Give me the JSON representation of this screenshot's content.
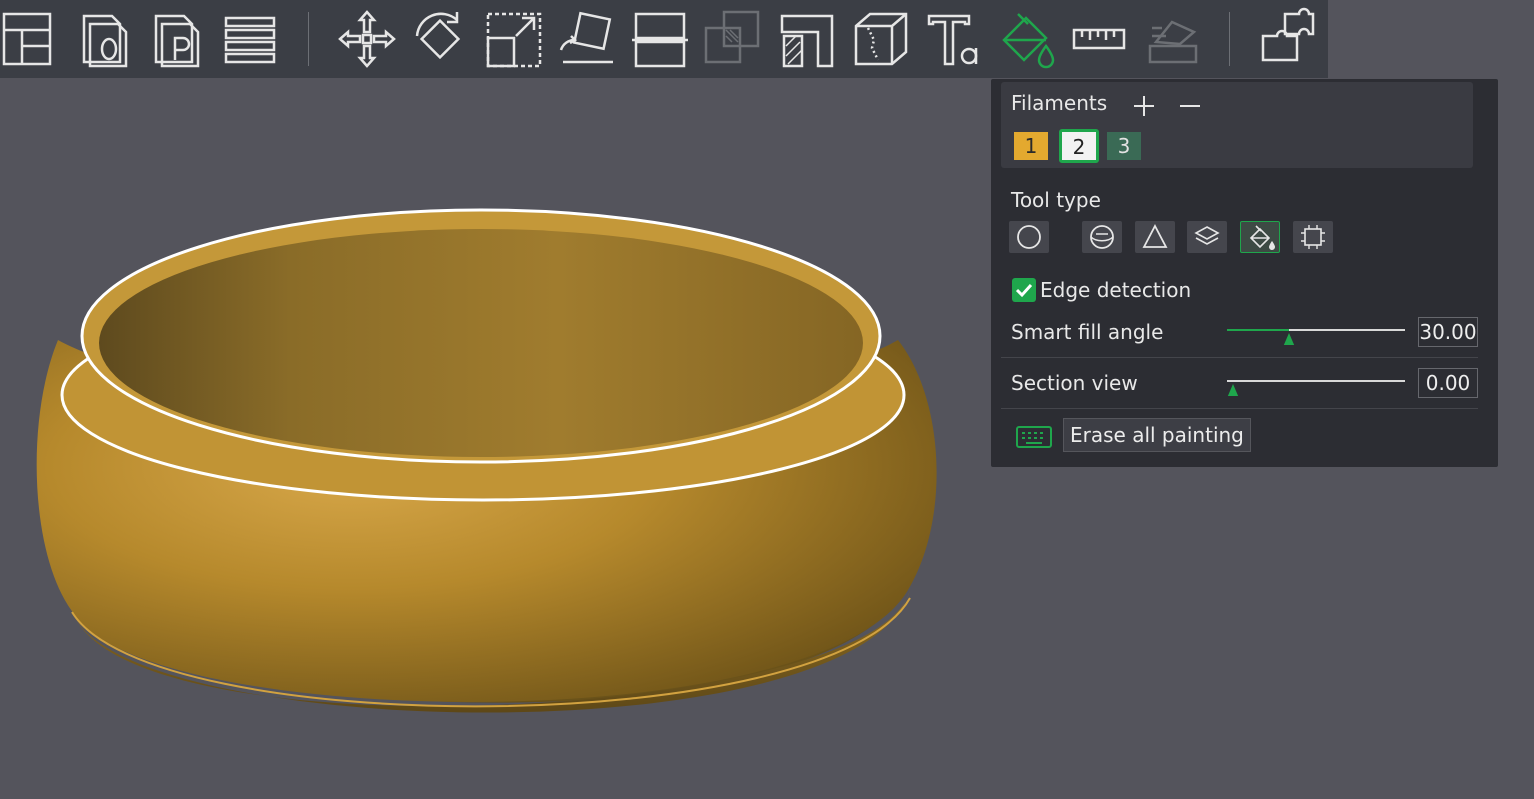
{
  "toolbar": {
    "icons": [
      "layout-icon",
      "object-list-icon",
      "plate-icon",
      "layers-icon",
      "move-icon",
      "rotate-icon",
      "scale-icon",
      "lay-on-face-icon",
      "cut-icon",
      "boolean-icon",
      "support-painting-icon",
      "seam-painting-icon",
      "text-icon",
      "color-painting-icon",
      "measure-icon",
      "assembly-icon",
      "assembly-view-icon"
    ]
  },
  "panel": {
    "filaments": {
      "label": "Filaments",
      "add": "+",
      "remove": "—",
      "chips": [
        {
          "label": "1",
          "color": "#e3a92f"
        },
        {
          "label": "2",
          "color": "#f2f2f2",
          "selected": true
        },
        {
          "label": "3",
          "color": "#3a6a55"
        }
      ]
    },
    "tool_type": {
      "label": "Tool type",
      "tools": [
        "circle-brush-icon",
        "sphere-brush-icon",
        "triangle-brush-icon",
        "height-range-icon",
        "fill-bucket-icon",
        "gap-fill-icon"
      ],
      "selected": "fill-bucket-icon"
    },
    "edge_detection": {
      "label": "Edge detection",
      "checked": true
    },
    "smart_fill_angle": {
      "label": "Smart fill angle",
      "value": "30.00"
    },
    "section_view": {
      "label": "Section view",
      "value": "0.00"
    },
    "erase_button": "Erase all painting"
  },
  "colors": {
    "accent": "#1fa64c",
    "model": "#c99a34",
    "background": "#54545c"
  }
}
